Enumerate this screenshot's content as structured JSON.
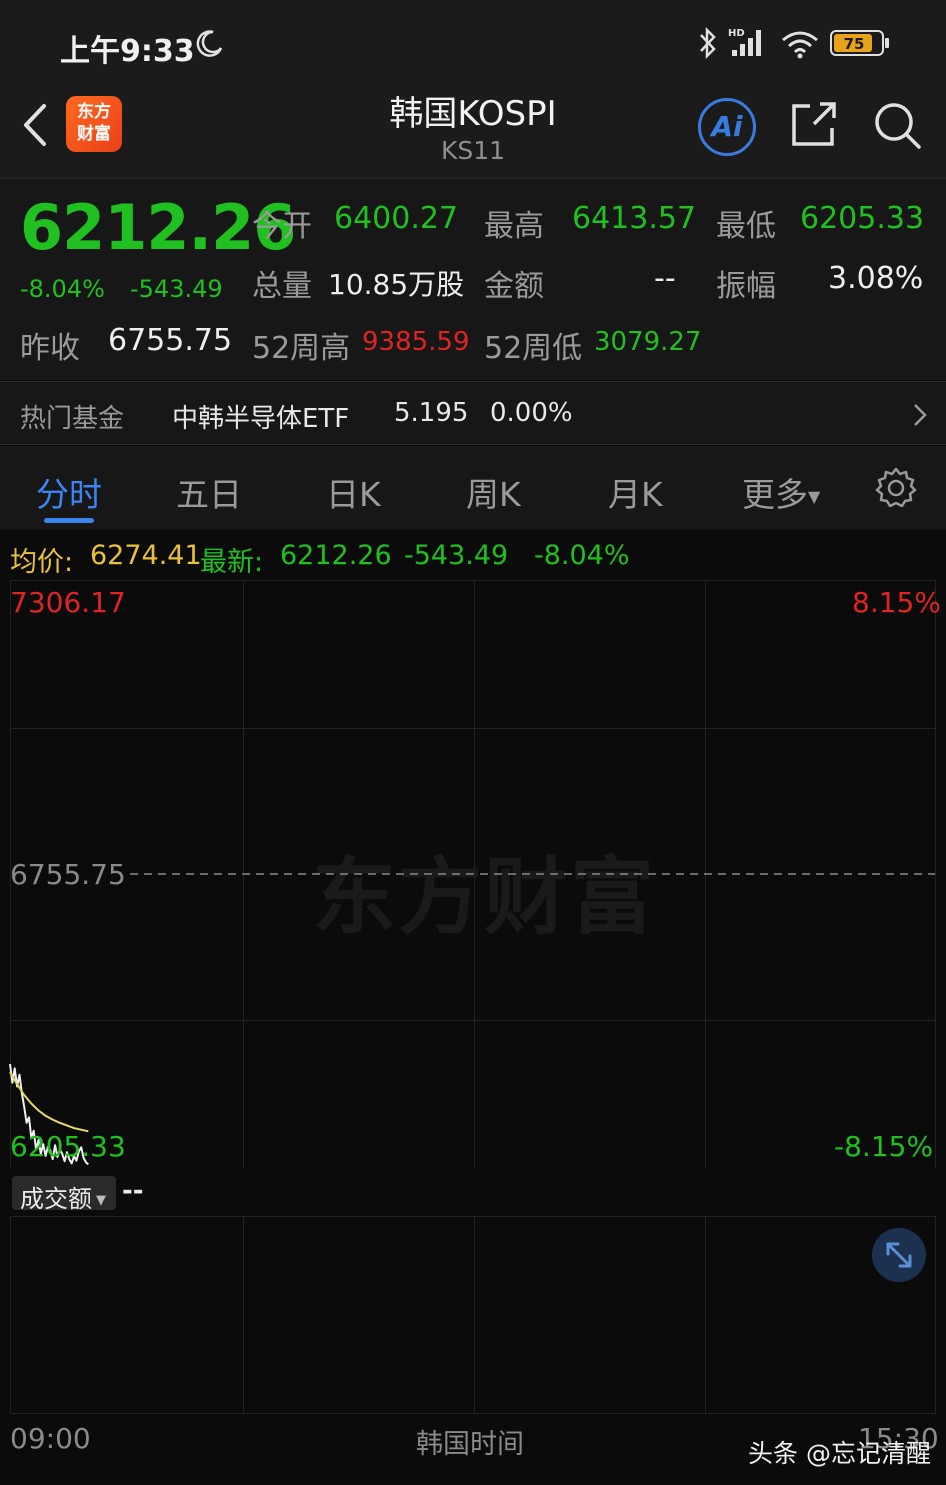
{
  "status_bar": {
    "time": "上午9:33",
    "battery": "75"
  },
  "header": {
    "logo_line1": "东方",
    "logo_line2": "财富",
    "title": "韩国KOSPI",
    "code": "KS11",
    "ai_label": "Ai"
  },
  "quote": {
    "price": "6212.26",
    "change_pct": "-8.04%",
    "change_abs": "-543.49",
    "open_label": "今开",
    "open_value": "6400.27",
    "high_label": "最高",
    "high_value": "6413.57",
    "low_label": "最低",
    "low_value": "6205.33",
    "volume_label": "总量",
    "volume_value": "10.85万股",
    "amount_label": "金额",
    "amount_value": "--",
    "amplitude_label": "振幅",
    "amplitude_value": "3.08%",
    "prev_close_label": "昨收",
    "prev_close_value": "6755.75",
    "wk52_high_label": "52周高",
    "wk52_high_value": "9385.59",
    "wk52_low_label": "52周低",
    "wk52_low_value": "3079.27",
    "colors": {
      "up": "#e02424",
      "down": "#1fc01f"
    }
  },
  "hot_fund": {
    "label": "热门基金",
    "name": "中韩半导体ETF",
    "price": "5.195",
    "change": "0.00%"
  },
  "tabs": [
    {
      "label": "分时",
      "active": true
    },
    {
      "label": "五日"
    },
    {
      "label": "日K"
    },
    {
      "label": "周K"
    },
    {
      "label": "月K"
    },
    {
      "label": "更多"
    }
  ],
  "info_line": {
    "avg_label": "均价:",
    "avg_value": "6274.41",
    "latest_label": "最新:",
    "latest_value": "6212.26",
    "change_abs": "-543.49",
    "change_pct": "-8.04%"
  },
  "chart_data": {
    "type": "line",
    "y_max_label": "7306.17",
    "y_mid_label": "6755.75",
    "y_min_label": "6205.33",
    "pct_max_label": "8.15%",
    "pct_min_label": "-8.15%",
    "ylim": [
      6205.33,
      7306.17
    ],
    "reference": 6755.75,
    "x_start_label": "09:00",
    "x_end_label": "15:30",
    "x_mid_label": "韩国时间",
    "session_minutes": 390,
    "series": [
      {
        "color": "#f0f0f0",
        "x": [
          0,
          1,
          2,
          3,
          4,
          5,
          6,
          7,
          8,
          9,
          10,
          11,
          12,
          13,
          14,
          15,
          16,
          17,
          18,
          19,
          20,
          21,
          22,
          23,
          24,
          25,
          26,
          27,
          28,
          29,
          30,
          31,
          32,
          33
        ],
        "values": [
          6400,
          6365,
          6392,
          6358,
          6380,
          6345,
          6320,
          6290,
          6300,
          6262,
          6275,
          6240,
          6258,
          6232,
          6250,
          6228,
          6245,
          6238,
          6222,
          6248,
          6226,
          6240,
          6232,
          6218,
          6235,
          6222,
          6214,
          6228,
          6219,
          6236,
          6244,
          6225,
          6216,
          6212
        ]
      },
      {
        "color": "#e8d86a",
        "x": [
          0,
          3,
          6,
          9,
          12,
          15,
          18,
          21,
          24,
          27,
          30,
          33
        ],
        "values": [
          6385,
          6362,
          6342,
          6326,
          6313,
          6303,
          6296,
          6290,
          6285,
          6280,
          6277,
          6274
        ]
      }
    ]
  },
  "watermark": "东方财富",
  "volume": {
    "selector_label": "成交额",
    "value": "--"
  },
  "credit": "头条 @忘记清醒"
}
